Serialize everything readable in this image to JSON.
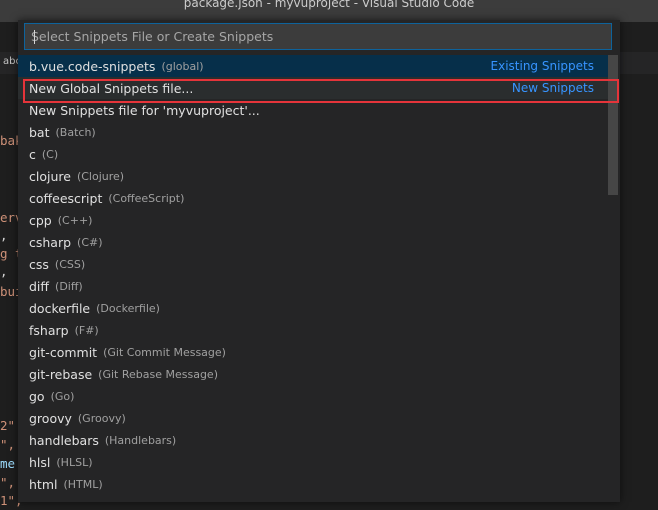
{
  "window": {
    "title": "package.json - myvuproject - Visual Studio Code"
  },
  "tabstrip": {
    "tab_fragment": "abc"
  },
  "editor_fragments": [
    {
      "text": "bak",
      "color": "#ce9178"
    },
    {
      "text": "erv",
      "color": "#ce9178"
    },
    {
      "text": ",",
      "color": "#d4d4d4"
    },
    {
      "text": "g t",
      "color": "#ce9178"
    },
    {
      "text": ",",
      "color": "#d4d4d4"
    },
    {
      "text": "bui",
      "color": "#ce9178"
    },
    {
      "text": "2\"",
      "color": "#ce9178"
    },
    {
      "text": "\",",
      "color": "#ce9178"
    },
    {
      "text": "me",
      "color": "#9cdcfe"
    },
    {
      "text": "\",",
      "color": "#ce9178"
    },
    {
      "text": "1\",",
      "color": "#ce9178"
    }
  ],
  "quickpick": {
    "placeholder": "Select Snippets File or Create Snippets",
    "items": [
      {
        "label": "b.vue.code-snippets",
        "desc": "(global)",
        "right": "Existing Snippets"
      },
      {
        "label": "New Global Snippets file...",
        "desc": "",
        "right": "New Snippets"
      },
      {
        "label": "New Snippets file for 'myvuproject'...",
        "desc": "",
        "right": ""
      },
      {
        "label": "bat",
        "desc": "(Batch)",
        "right": ""
      },
      {
        "label": "c",
        "desc": "(C)",
        "right": ""
      },
      {
        "label": "clojure",
        "desc": "(Clojure)",
        "right": ""
      },
      {
        "label": "coffeescript",
        "desc": "(CoffeeScript)",
        "right": ""
      },
      {
        "label": "cpp",
        "desc": "(C++)",
        "right": ""
      },
      {
        "label": "csharp",
        "desc": "(C#)",
        "right": ""
      },
      {
        "label": "css",
        "desc": "(CSS)",
        "right": ""
      },
      {
        "label": "diff",
        "desc": "(Diff)",
        "right": ""
      },
      {
        "label": "dockerfile",
        "desc": "(Dockerfile)",
        "right": ""
      },
      {
        "label": "fsharp",
        "desc": "(F#)",
        "right": ""
      },
      {
        "label": "git-commit",
        "desc": "(Git Commit Message)",
        "right": ""
      },
      {
        "label": "git-rebase",
        "desc": "(Git Rebase Message)",
        "right": ""
      },
      {
        "label": "go",
        "desc": "(Go)",
        "right": ""
      },
      {
        "label": "groovy",
        "desc": "(Groovy)",
        "right": ""
      },
      {
        "label": "handlebars",
        "desc": "(Handlebars)",
        "right": ""
      },
      {
        "label": "hlsl",
        "desc": "(HLSL)",
        "right": ""
      },
      {
        "label": "html",
        "desc": "(HTML)",
        "right": ""
      }
    ]
  },
  "colors": {
    "accent": "#3794ff",
    "highlight_box": "#e5343a",
    "active_row": "#062f4a"
  }
}
